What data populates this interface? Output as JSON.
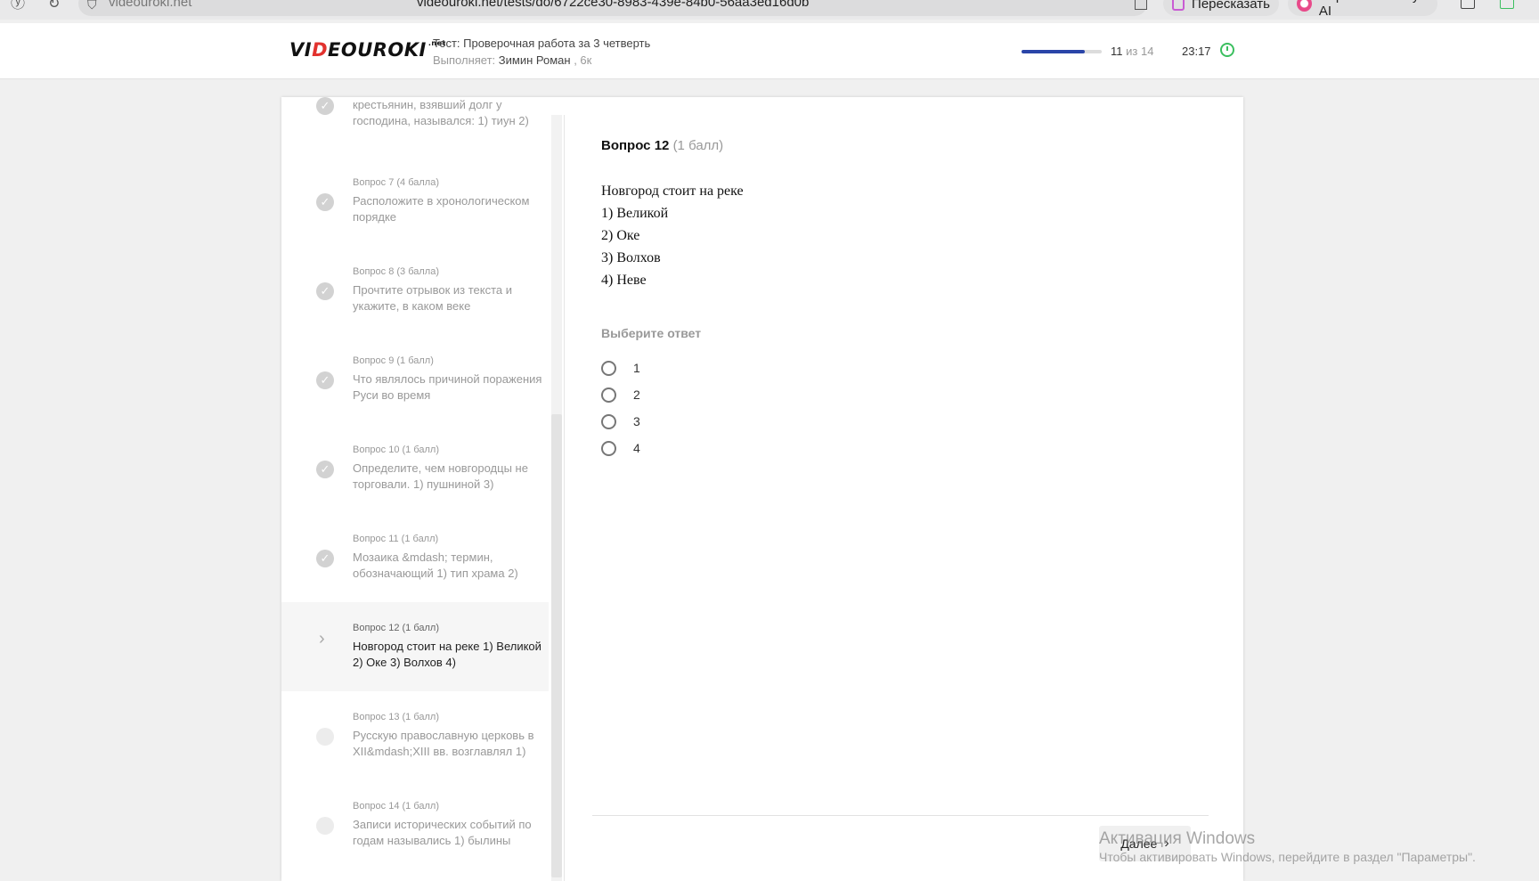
{
  "browser": {
    "domain": "videouroki.net",
    "url": "videouroki.net/tests/do/6722ce30-8983-439e-84b0-56aa3ed16d0b",
    "retell_label": "Пересказать",
    "alice_label": "Спросить Алису AI"
  },
  "header": {
    "logo_a": "VI",
    "logo_red": "D",
    "logo_b": "EOUROKI",
    "logo_small": ".net",
    "test_title": "Тест: Проверочная работа за 3 четверть",
    "performer_label": "Выполняет:",
    "performer_name": "Зимин Роман",
    "performer_class": ", 6к",
    "progress_current": "11",
    "progress_total": "из 14",
    "progress_fraction": 0.79,
    "timer": "23:17"
  },
  "sidebar": {
    "items": [
      {
        "head": "",
        "text": "крестьянин, взявший долг у господина, назывался: 1) тиун 2)",
        "state": "done"
      },
      {
        "head": "Вопрос 7 (4 балла)",
        "text": "Расположите в хронологическом порядке",
        "state": "done"
      },
      {
        "head": "Вопрос 8 (3 балла)",
        "text": "Прочтите отрывок из текста и укажите, в каком веке",
        "state": "done"
      },
      {
        "head": "Вопрос 9 (1 балл)",
        "text": "Что являлось причиной поражения Руси во время",
        "state": "done"
      },
      {
        "head": "Вопрос 10 (1 балл)",
        "text": "Определите, чем новгородцы не торговали. 1) пушниной 3)",
        "state": "done"
      },
      {
        "head": "Вопрос 11 (1 балл)",
        "text": "Мозаика &mdash; термин, обозначающий 1) тип храма 2)",
        "state": "done"
      },
      {
        "head": "Вопрос 12 (1 балл)",
        "text": "Новгород стоит на реке 1) Великой 2) Оке 3) Волхов 4)",
        "state": "active"
      },
      {
        "head": "Вопрос 13 (1 балл)",
        "text": "Русскую православную церковь в XII&mdash;XIII вв. возглавлял 1)",
        "state": "todo"
      },
      {
        "head": "Вопрос 14 (1 балл)",
        "text": "Записи исторических событий по годам назывались 1) былины",
        "state": "todo"
      }
    ]
  },
  "question": {
    "title": "Вопрос 12",
    "points": "(1 балл)",
    "lines": [
      "Новгород стоит на реке",
      "1) Великой",
      "2) Оке",
      "3) Волхов",
      "4) Неве"
    ],
    "choose_label": "Выберите ответ",
    "options": [
      "1",
      "2",
      "3",
      "4"
    ],
    "next_label": "Далее"
  },
  "watermark": {
    "line1": "Активация Windows",
    "line2": "Чтобы активировать Windows, перейдите в раздел \"Параметры\"."
  }
}
